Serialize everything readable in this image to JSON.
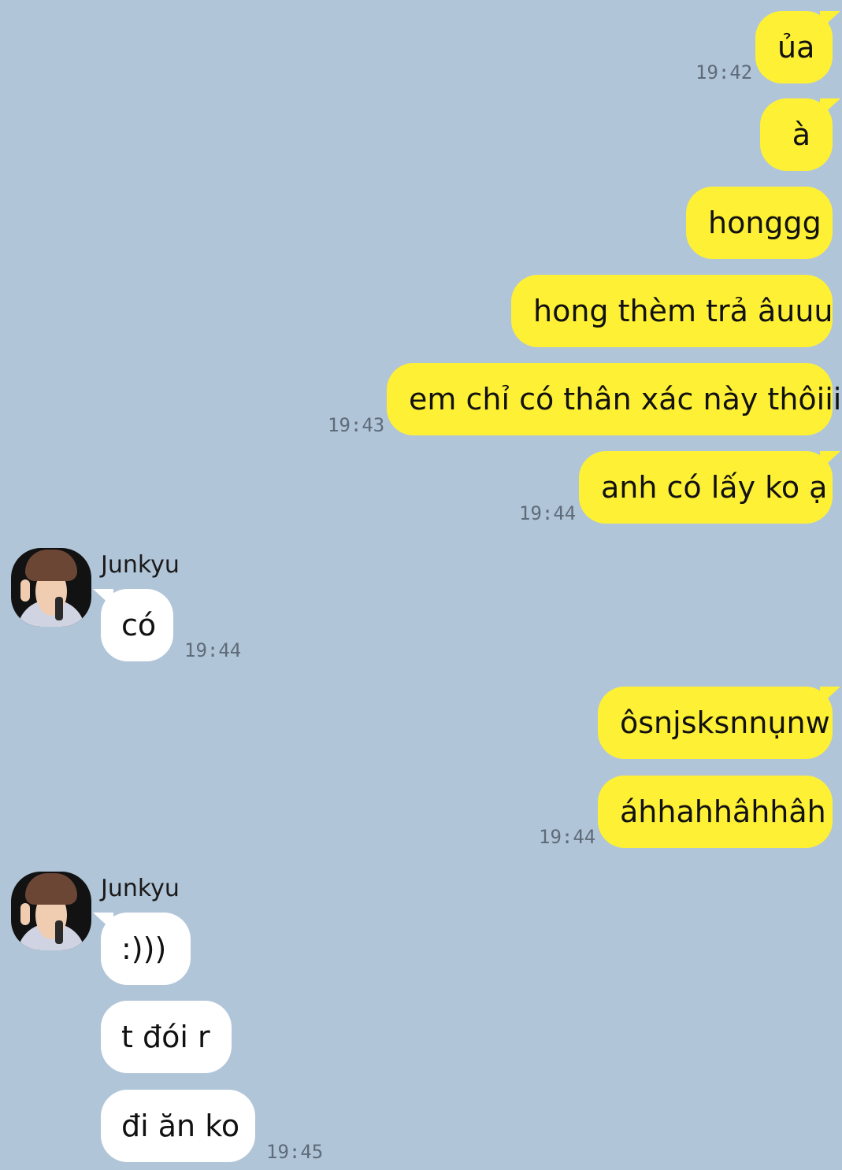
{
  "theme": {
    "background": "#b1c5d9",
    "outgoing_bubble": "#fef035",
    "incoming_bubble": "#ffffff"
  },
  "messages": [
    {
      "dir": "out",
      "text": "ủa",
      "time": "19:42"
    },
    {
      "dir": "out",
      "text": "à",
      "time": ""
    },
    {
      "dir": "out",
      "text": "honggg",
      "time": ""
    },
    {
      "dir": "out",
      "text": "hong thèm trả âuuu",
      "time": ""
    },
    {
      "dir": "out",
      "text": "em chỉ có thân xác này thôiii",
      "time": "19:43"
    },
    {
      "dir": "out",
      "text": "anh có lấy ko ạ",
      "time": "19:44"
    },
    {
      "dir": "in",
      "sender": "Junkyu",
      "text": "có",
      "time": "19:44"
    },
    {
      "dir": "out",
      "text": "ôsnjsksnnụnw",
      "time": ""
    },
    {
      "dir": "out",
      "text": "áhhahhâhhâh",
      "time": "19:44"
    },
    {
      "dir": "in",
      "sender": "Junkyu",
      "text": ":)))",
      "time": ""
    },
    {
      "dir": "in",
      "text": "t đói r",
      "time": ""
    },
    {
      "dir": "in",
      "text": "đi ăn ko",
      "time": "19:45"
    }
  ]
}
